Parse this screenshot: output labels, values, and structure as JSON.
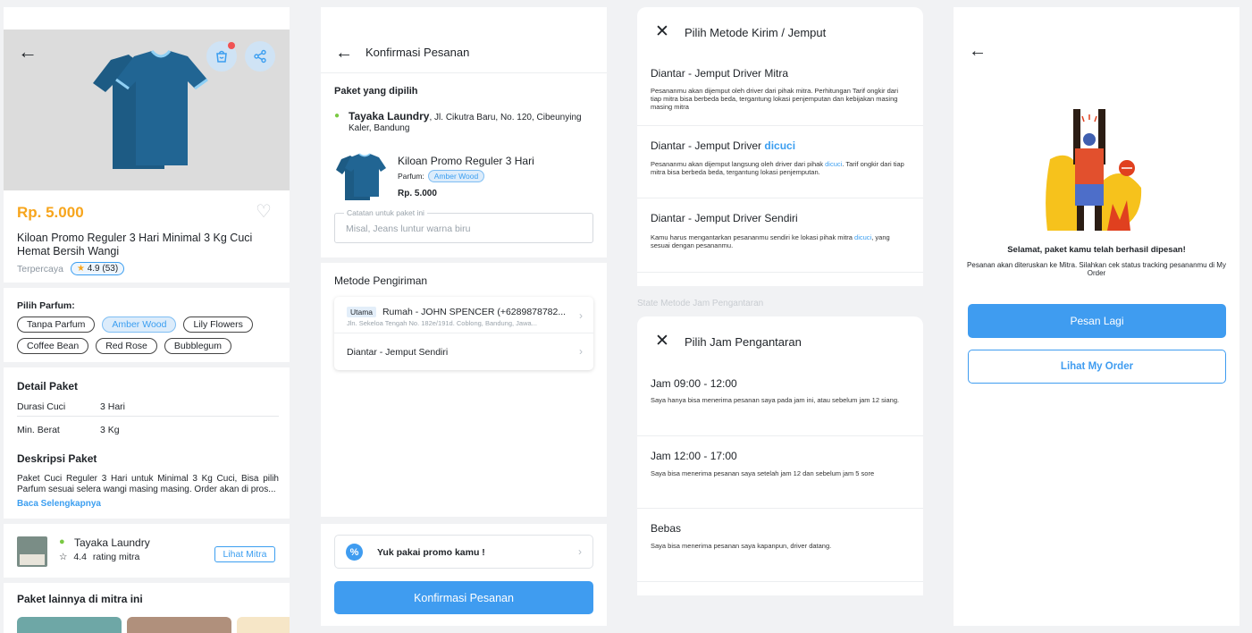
{
  "detail": {
    "price": "Rp. 5.000",
    "product_name": "Kiloan Promo Reguler 3 Hari Minimal 3 Kg Cuci Hemat Bersih Wangi",
    "trusted": "Terpercaya",
    "rating": "4.9",
    "rating_count": "(53)",
    "perfume_title": "Pilih Parfum:",
    "perfumes": [
      "Tanpa Parfum",
      "Amber Wood",
      "Lily Flowers",
      "Coffee Bean",
      "Red Rose",
      "Bubblegum"
    ],
    "selected_perfume": "Amber Wood",
    "detail_title": "Detail Paket",
    "rows": [
      {
        "key": "Durasi Cuci",
        "value": "3 Hari"
      },
      {
        "key": "Min. Berat",
        "value": "3 Kg"
      }
    ],
    "desc_title": "Deskripsi Paket",
    "description": "Paket Cuci Reguler 3 Hari untuk Minimal 3 Kg Cuci, Bisa pilih Parfum sesuai selera wangi masing masing. Order akan di pros...",
    "read_more": "Baca Selengkapnya",
    "mitra_name": "Tayaka Laundry",
    "mitra_rating": "4.4",
    "mitra_rating_label": "rating mitra",
    "mitra_button": "Lihat Mitra",
    "others_title": "Paket lainnya di mitra ini"
  },
  "confirm": {
    "title": "Konfirmasi Pesanan",
    "selected_label": "Paket yang dipilih",
    "laundry_name": "Tayaka Laundry",
    "laundry_address": ", Jl. Cikutra Baru, No. 120, Cibeunying Kaler, Bandung",
    "package_name": "Kiloan Promo Reguler 3 Hari",
    "perfume_label": "Parfum:",
    "perfume_value": "Amber Wood",
    "package_price": "Rp. 5.000",
    "note_label": "Catatan untuk paket ini",
    "note_placeholder": "Misal, Jeans luntur warna biru",
    "shipping_title": "Metode Pengiriman",
    "main_badge": "Utama",
    "address_name": "Rumah - JOHN SPENCER (+6289878782...",
    "address_detail": "Jln. Sekeloa Tengah No. 182e/191d. Coblong, Bandung, Jawa...",
    "delivery_option": "Diantar - Jemput Sendiri",
    "promo": "Yuk pakai promo kamu !",
    "confirm_button": "Konfirmasi Pesanan"
  },
  "method_sheet": {
    "title": "Pilih Metode Kirim / Jemput",
    "brand": "dicuci",
    "options": [
      {
        "title": "Diantar - Jemput Driver Mitra",
        "desc": "Pesananmu akan dijemput oleh driver dari pihak mitra. Perhitungan Tarif ongkir dari tiap mitra bisa berbeda beda, tergantung lokasi penjemputan dan kebijakan masing masing mitra"
      },
      {
        "title": "Diantar - Jemput Driver ",
        "desc_a": "Pesananmu akan dijemput langsung oleh driver dari pihak ",
        "desc_b": ". Tarif ongkir dari tiap mitra bisa berbeda beda, tergantung lokasi penjemputan."
      },
      {
        "title": "Diantar - Jemput Driver Sendiri",
        "desc_a": "Kamu harus mengantarkan pesananmu sendiri ke lokasi pihak mitra ",
        "desc_b": ", yang sesuai dengan pesananmu."
      }
    ]
  },
  "state_label": "State Metode Jam Pengantaran",
  "time_sheet": {
    "title": "Pilih Jam Pengantaran",
    "options": [
      {
        "title": "Jam 09:00 - 12:00",
        "desc": "Saya hanya bisa menerima pesanan saya pada jam ini, atau sebelum jam 12 siang."
      },
      {
        "title": "Jam 12:00 - 17:00",
        "desc": "Saya bisa menerima pesanan saya setelah jam 12 dan sebelum jam 5 sore"
      },
      {
        "title": "Bebas",
        "desc": "Saya bisa menerima pesanan saya kapanpun, driver datang."
      }
    ]
  },
  "success": {
    "message": "Selamat, paket kamu telah berhasil dipesan!",
    "sub": "Pesanan akan diteruskan ke Mitra. Silahkan cek status tracking pesananmu di My Order",
    "primary_button": "Pesan Lagi",
    "secondary_button": "Lihat My Order"
  },
  "colors": {
    "accent": "#3f9cf0",
    "price": "#f7a51c",
    "brand_green": "#7ac943"
  },
  "icons": [
    "back-arrow-icon",
    "cart-icon",
    "share-icon",
    "heart-icon",
    "star-icon",
    "location-pin-icon",
    "chevron-right-icon",
    "promo-icon",
    "close-icon"
  ]
}
